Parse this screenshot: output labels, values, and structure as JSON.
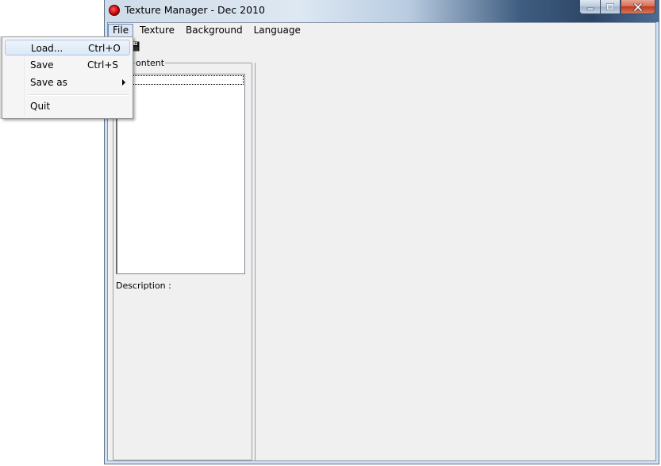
{
  "window": {
    "title": "Texture Manager - Dec 2010",
    "icon": "app-icon",
    "caption_buttons": [
      "minimize-icon",
      "maximize-icon",
      "close-icon"
    ]
  },
  "menubar": {
    "items": [
      {
        "label": "File",
        "open": true
      },
      {
        "label": "Texture"
      },
      {
        "label": "Background"
      },
      {
        "label": "Language"
      }
    ]
  },
  "file_menu": {
    "items": [
      {
        "label": "Load...",
        "shortcut": "Ctrl+O",
        "highlighted": true
      },
      {
        "label": "Save",
        "shortcut": "Ctrl+S"
      },
      {
        "label": "Save as",
        "shortcut": "",
        "submenu": true
      },
      {
        "label": "Quit",
        "shortcut": ""
      }
    ]
  },
  "toolbar": {
    "save_icon": "save-icon"
  },
  "content_group": {
    "label": "ontent"
  },
  "description": {
    "label": "Description :"
  },
  "colors": {
    "titlebar_dark": "#2c4566",
    "close_button": "#c1381d",
    "menu_highlight": "#dce8f6"
  }
}
